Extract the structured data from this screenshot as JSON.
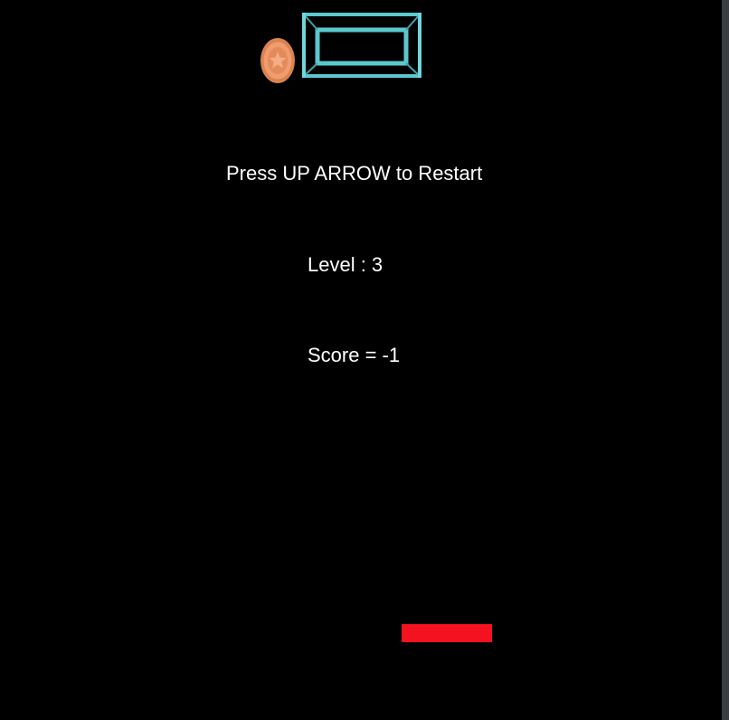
{
  "game": {
    "restart_message": "Press UP ARROW to Restart",
    "level_text": "Level : 3",
    "score_text": "Score = -1"
  },
  "colors": {
    "background": "#000000",
    "text": "#ffffff",
    "paddle": "#f5121f",
    "goal": "#5bc8cf",
    "coin": "#e8956a"
  },
  "icons": {
    "coin": "star-coin-icon",
    "goal": "goal-frame-icon"
  }
}
